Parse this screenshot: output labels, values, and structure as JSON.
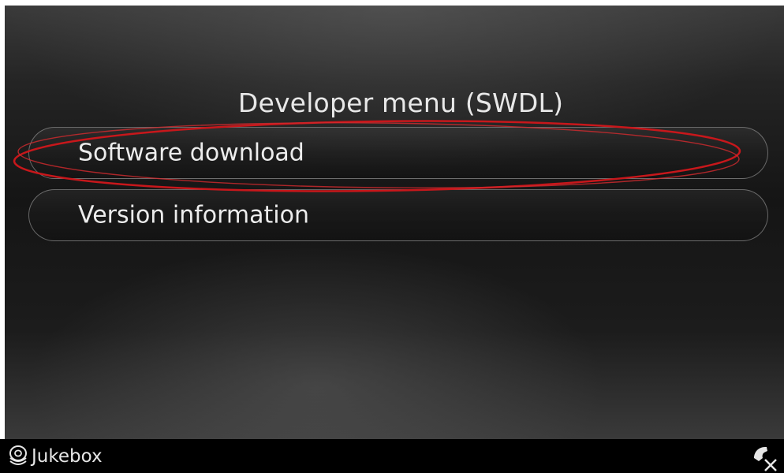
{
  "screen": {
    "title": "Developer menu (SWDL)"
  },
  "menu": {
    "items": [
      {
        "label": "Software download",
        "highlighted": true
      },
      {
        "label": "Version information",
        "highlighted": false
      }
    ]
  },
  "statusbar": {
    "source_icon": "jukebox-disc-stack-icon",
    "source_label": "Jukebox",
    "phone_icon": "phone-disconnected-icon"
  },
  "colors": {
    "annotation": "#c8171b",
    "text": "#ececec"
  }
}
